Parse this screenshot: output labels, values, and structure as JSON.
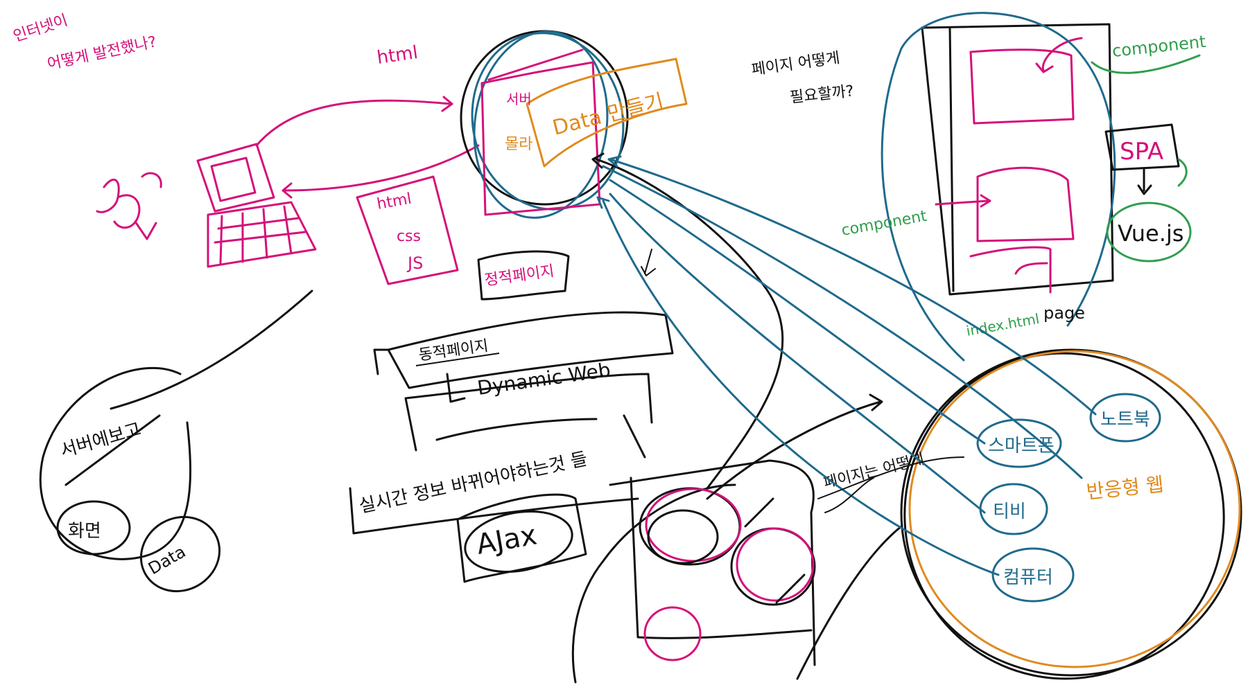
{
  "colors": {
    "magenta": "#d4117a",
    "black": "#111111",
    "blue": "#1f6a8c",
    "orange": "#e08a1e",
    "green": "#2f9e4d"
  },
  "labels": {
    "top_left_question": [
      "인터넷이",
      "어떻게 발전했나?"
    ],
    "html_top": "html",
    "server": "서버",
    "server_data": "Data 만들기",
    "server_mole": "몰라",
    "html_css_js": [
      "html",
      "css",
      "JS"
    ],
    "static_page": "정적페이지",
    "dynamic_page": "동적페이지",
    "dynamic_web": "Dynamic  Web",
    "realtime": "실시간 정보 바뀌어야하는것 들",
    "ajax": "AJax",
    "server_ops": "서버에보고",
    "screen": "화면",
    "data_small": "Data",
    "why_page_question": [
      "페이지 어떻게",
      "필요할까?"
    ],
    "component_top": "component",
    "component_left": "component",
    "spa": "SPA",
    "vuejs": "Vue.js",
    "index_html": "index.html",
    "page": "page",
    "page_how": "페이지는 어떻게",
    "smartphone": "스마트폰",
    "notebook": "노트북",
    "tv": "티비",
    "computer": "컴퓨터",
    "responsive_web": "반응형 웹"
  }
}
